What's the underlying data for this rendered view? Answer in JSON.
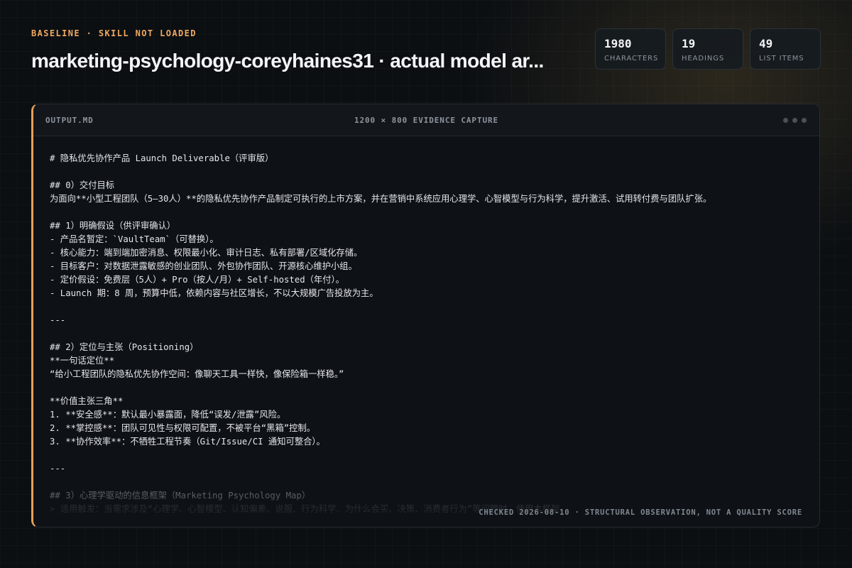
{
  "header": {
    "eyebrow": "BASELINE · SKILL NOT LOADED",
    "title": "marketing-psychology-coreyhaines31 · actual model ar..."
  },
  "stats": [
    {
      "value": "1980",
      "label": "CHARACTERS"
    },
    {
      "value": "19",
      "label": "HEADINGS"
    },
    {
      "value": "49",
      "label": "LIST ITEMS"
    }
  ],
  "panel": {
    "filename": "OUTPUT.MD",
    "caption": "1200 × 800 EVIDENCE CAPTURE",
    "lines": [
      "# 隐私优先协作产品 Launch Deliverable（评审版）",
      "",
      "## 0）交付目标",
      "为面向**小型工程团队（5–30人）**的隐私优先协作产品制定可执行的上市方案，并在营销中系统应用心理学、心智模型与行为科学，提升激活、试用转付费与团队扩张。",
      "",
      "## 1）明确假设（供评审确认）",
      "- 产品名暂定：`VaultTeam`（可替换）。",
      "- 核心能力：端到端加密消息、权限最小化、审计日志、私有部署/区域化存储。",
      "- 目标客户：对数据泄露敏感的创业团队、外包协作团队、开源核心维护小组。",
      "- 定价假设：免费层（5人）+ Pro（按人/月）+ Self-hosted（年付）。",
      "- Launch 期：8 周，预算中低，依赖内容与社区增长，不以大规模广告投放为主。",
      "",
      "---",
      "",
      "## 2）定位与主张（Positioning）",
      "**一句话定位**",
      "“给小工程团队的隐私优先协作空间：像聊天工具一样快，像保险箱一样稳。”",
      "",
      "**价值主张三角**",
      "1. **安全感**：默认最小暴露面，降低“误发/泄露”风险。",
      "2. **掌控感**：团队可见性与权限可配置，不被平台“黑箱”控制。",
      "3. **协作效率**：不牺牲工程节奏（Git/Issue/CI 通知可整合）。",
      "",
      "---",
      "",
      "## 3）心理学驱动的信息框架（Marketing Psychology Map）",
      "> 适用触发：当需求涉及“心理学、心智模型、认知偏差、说服、行为科学、为什么会买、决策、消费者行为”等问题时，使用本框架。"
    ],
    "footer_note": "CHECKED 2026-08-10 · STRUCTURAL OBSERVATION, NOT A QUALITY SCORE"
  }
}
